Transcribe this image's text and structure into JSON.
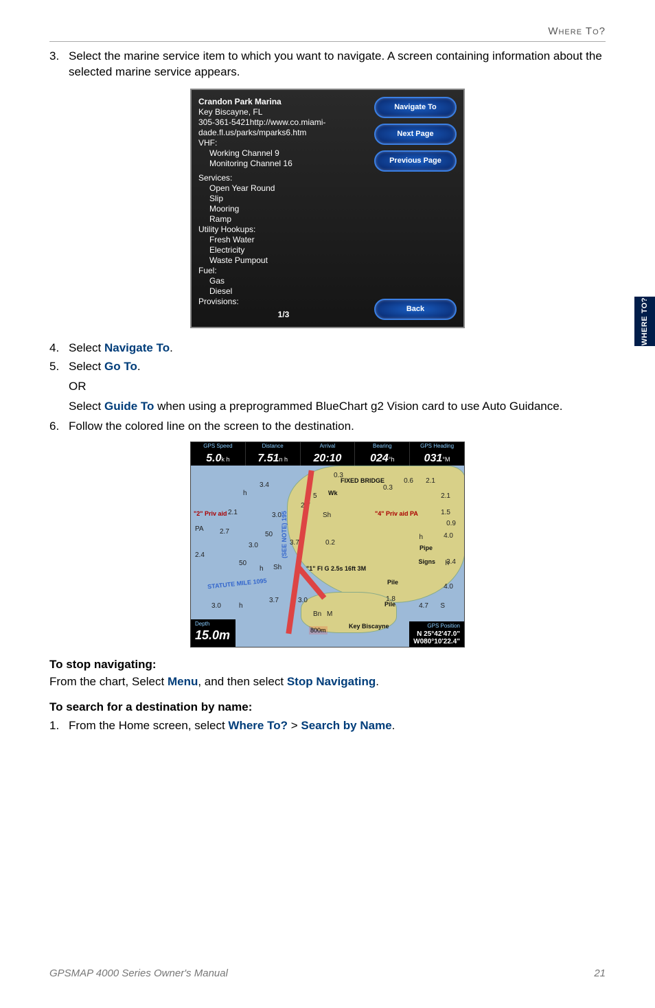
{
  "header": {
    "section": "Where To?"
  },
  "sideTab": "WHERE TO?",
  "steps": {
    "s3": {
      "num": "3.",
      "text": "Select the marine service item to which you want to navigate. A screen containing information about the selected marine service appears."
    },
    "s4": {
      "num": "4.",
      "pre": "Select ",
      "link": "Navigate To",
      "post": "."
    },
    "s5": {
      "num": "5.",
      "pre": "Select ",
      "link": "Go To",
      "post": "."
    },
    "or": "OR",
    "s5b": {
      "pre": "Select ",
      "link": "Guide To",
      "post": " when using a preprogrammed BlueChart g2 Vision card to use Auto Guidance."
    },
    "s6": {
      "num": "6.",
      "text": "Follow the colored line on the screen to the destination."
    }
  },
  "screenshot1": {
    "title": "Crandon Park Marina",
    "loc": "Key Biscayne, FL",
    "contact": "305-361-5421http://www.co.miami-dade.fl.us/parks/mparks6.htm",
    "vhfLabel": "VHF:",
    "vhf1": "Working Channel 9",
    "vhf2": "Monitoring Channel 16",
    "servicesLabel": "Services:",
    "svc1": "Open Year Round",
    "svc2": "Slip",
    "svc3": "Mooring",
    "svc4": "Ramp",
    "hookupsLabel": "Utility Hookups:",
    "hk1": "Fresh Water",
    "hk2": "Electricity",
    "hk3": "Waste Pumpout",
    "fuelLabel": "Fuel:",
    "fuel1": "Gas",
    "fuel2": "Diesel",
    "provLabel": "Provisions:",
    "page": "1/3",
    "btns": {
      "nav": "Navigate To",
      "next": "Next Page",
      "prev": "Previous Page",
      "back": "Back"
    }
  },
  "chart_data": {
    "type": "table",
    "databar": [
      {
        "label": "GPS Speed",
        "value": "5.0",
        "unit": "k h"
      },
      {
        "label": "Distance",
        "value": "7.51",
        "unit": "n h"
      },
      {
        "label": "Arrival",
        "value": "20:10",
        "unit": ""
      },
      {
        "label": "Bearing",
        "value": "024",
        "unit": "°h"
      },
      {
        "label": "GPS Heading",
        "value": "031",
        "unit": "°M"
      }
    ],
    "depth": {
      "label": "Depth",
      "value": "15.0",
      "unit": "m"
    },
    "gps": {
      "label": "GPS Position",
      "lat": "N 25°42'47.0\"",
      "lon": "W080°10'22.4\""
    },
    "annotations": {
      "fixedBridge": "FIXED BRIDGE",
      "privAid1": "\"2\" Priv aid",
      "privAid2": "\"4\" Priv aid PA",
      "light": "\"1\" Fl G 2.5s 16ft 3M",
      "statute": "STATUTE MILE 1095",
      "seeNote": "(SEE NOTE) 195",
      "keyBiscayne": "Key Biscayne",
      "signs": "Signs",
      "pipe": "Pipe",
      "pile1": "Pile",
      "pile2": "Pile",
      "wk": "Wk",
      "scale": "800m"
    },
    "soundings": [
      "3.4",
      "2.7",
      "3.0",
      "2.4",
      "3.0",
      "2.1",
      "3.0",
      "3.7",
      "3.7",
      "3.0",
      "2.7",
      "5",
      "0.3",
      "0.3",
      "0.2",
      "0.6",
      "2.1",
      "2.1",
      "1.5",
      "0.9",
      "4.0",
      "3.4",
      "4.0",
      "1.8",
      "4.7",
      "50",
      "50",
      "PA",
      "Sh",
      "Sh",
      "h",
      "h",
      "h",
      "h",
      "h",
      "S",
      "Bn",
      "M"
    ]
  },
  "stopNav": {
    "heading": "To stop navigating:",
    "pre": "From the chart, Select ",
    "link1": "Menu",
    "mid": ", and then select ",
    "link2": "Stop Navigating",
    "post": "."
  },
  "searchName": {
    "heading": "To search for a destination by name:",
    "num": "1.",
    "pre": "From the Home screen, select ",
    "link1": "Where To?",
    "sep": " > ",
    "link2": "Search by Name",
    "post": "."
  },
  "footer": {
    "left": "GPSMAP 4000 Series Owner's Manual",
    "right": "21"
  }
}
